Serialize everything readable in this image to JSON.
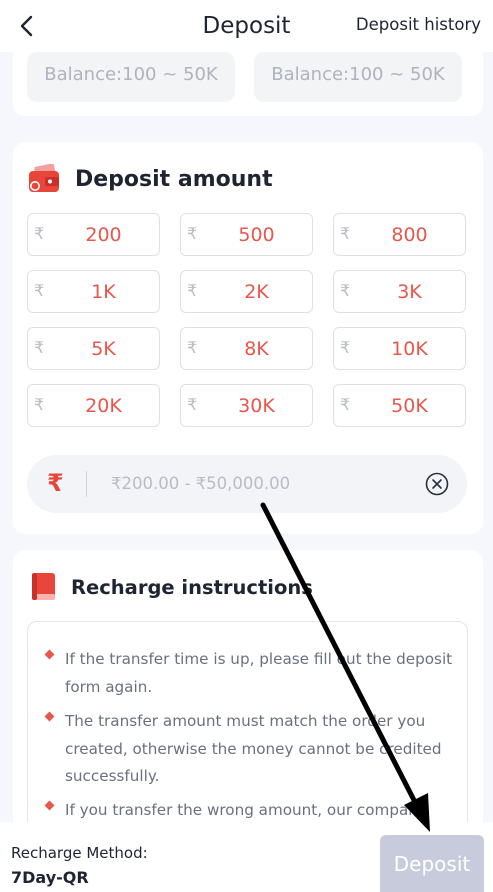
{
  "header": {
    "title": "Deposit",
    "history_label": "Deposit history"
  },
  "balance_boxes": [
    {
      "text": "Balance:100 ~ 50K"
    },
    {
      "text": "Balance:100 ~ 50K"
    }
  ],
  "amount_section": {
    "title": "Deposit amount",
    "currency_symbol": "₹",
    "options": [
      "200",
      "500",
      "800",
      "1K",
      "2K",
      "3K",
      "5K",
      "8K",
      "10K",
      "20K",
      "30K",
      "50K"
    ],
    "input": {
      "value": "",
      "placeholder": "₹200.00 - ₹50,000.00",
      "prefix": "₹"
    }
  },
  "instructions": {
    "title": "Recharge instructions",
    "items": [
      "If the transfer time is up, please fill out the deposit form again.",
      "The transfer amount must match the order you created, otherwise the money cannot be credited successfully.",
      "If you transfer the wrong amount, our company will"
    ]
  },
  "bottom": {
    "method_label": "Recharge Method:",
    "method_value": "7Day-QR",
    "deposit_label": "Deposit"
  },
  "colors": {
    "accent_red": "#e8574c",
    "deposit_disabled": "#c8cbdb",
    "background": "#f6f7fc"
  }
}
